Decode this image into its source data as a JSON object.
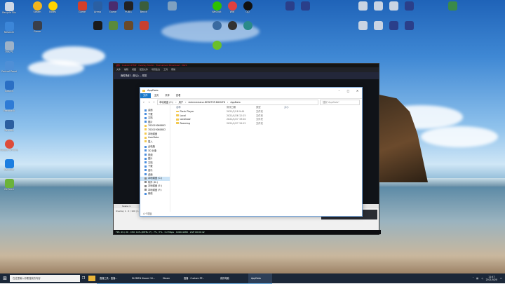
{
  "desktop": {
    "left_icons": [
      "Recycle Bin",
      "Network",
      "This PC",
      "Control Panel",
      "Search",
      "Feedback",
      "Remote",
      "Google Chrome",
      "Security",
      "GeForce"
    ],
    "top_icons": [
      "Steam",
      "Notes",
      "Game",
      "Game",
      "Arena",
      "Game",
      "PUBG",
      "Bench",
      "WeChat",
      "WW",
      "QQ",
      "App",
      "App",
      "App",
      "App"
    ],
    "top_right_icons": [
      "Tool",
      "Tool",
      "Tool",
      "Tool",
      "Tool",
      "Tool",
      "Folder",
      "Bin"
    ]
  },
  "dark_app": {
    "title": "战旗 · Custom RTMP · Overlay Studio · Tournament Broadcast · 2021",
    "menu": [
      "文件",
      "编辑",
      "视图",
      "配置文件",
      "场景集合",
      "工具",
      "帮助"
    ],
    "tab": "我的场景 1 (默认) — 预览",
    "bottom_tab": "Scene 1",
    "bottom_text": "Overlay 1 · 0 / 100 | 1 ...",
    "right_buttons": [
      "Scene 1",
      "+"
    ],
    "status": "FPS: 29 / 29 · CPU: 14% (INTEL I7) · 7% / 7% · 3.2 Mbps · 1920x1080 · LIVE 00:00:42"
  },
  "explorer": {
    "title": "AppData",
    "ribbon": [
      "文件",
      "主页",
      "共享",
      "查看"
    ],
    "path": [
      "本地磁盘 (C:)",
      "用户",
      "Administrator.DESKTOP-B0NVF8",
      "AppData"
    ],
    "search_placeholder": "搜索\"AppData\"",
    "nav": [
      {
        "label": "桌面"
      },
      {
        "label": "下载"
      },
      {
        "label": "文档"
      },
      {
        "label": "图片"
      },
      {
        "label": "702019060802"
      },
      {
        "label": "702019060802"
      },
      {
        "label": "本地磁盘"
      },
      {
        "label": "UserData"
      },
      {
        "label": "插入"
      },
      {
        "label": "此电脑"
      },
      {
        "label": "3D 对象"
      },
      {
        "label": "视频"
      },
      {
        "label": "图片"
      },
      {
        "label": "文档"
      },
      {
        "label": "下载"
      },
      {
        "label": "音乐"
      },
      {
        "label": "桌面"
      },
      {
        "label": "本地磁盘 (C:)"
      },
      {
        "label": "软件 (D:)"
      },
      {
        "label": "本地磁盘 (E:)"
      },
      {
        "label": "本地磁盘 (F:)"
      },
      {
        "label": "网络"
      }
    ],
    "headers": [
      "名称",
      "修改日期",
      "类型",
      "大小"
    ],
    "rows": [
      {
        "name": "Flash Player",
        "date": "2021/2/18 9:44",
        "type": "文件夹"
      },
      {
        "name": "Local",
        "date": "2021/4/26 12:15",
        "type": "文件夹"
      },
      {
        "name": "LocalLow",
        "date": "2021/4/27 19:20",
        "type": "文件夹"
      },
      {
        "name": "Roaming",
        "date": "2021/4/27 19:12",
        "type": "文件夹"
      }
    ],
    "footer": "4 个项目"
  },
  "taskbar": {
    "search_placeholder": "在这里输入你要搜索的内容",
    "buttons": [
      "直播工具 - 直播...",
      "ELEMEN Xiaomi 10...",
      "Steam",
      "直播 · Custom RT...",
      "我的电脑",
      "AppData"
    ],
    "time": "11:47",
    "date": "2021/5/20"
  }
}
